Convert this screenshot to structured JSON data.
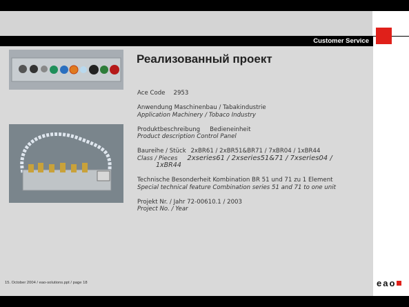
{
  "header": {
    "customer_service": "Customer Service"
  },
  "title": "Реализованный проект",
  "info": {
    "ace_label": "Ace Code",
    "ace_value": "2953",
    "anwendung_label": "Anwendung",
    "anwendung_value": "Maschinenbau / Tabakindustrie",
    "application_label": "Application",
    "application_value": "Machinery / Tobaco Industry",
    "produkt_label": "Produktbeschreibung",
    "produkt_value": "Bedieneinheit",
    "product_label": "Product description",
    "product_value": "Control Panel",
    "baureihe_label": "Baureihe / Stück",
    "baureihe_value": "2xBR61 / 2xBR51&BR71 / 7xBR04 / 1xBR44",
    "class_label": "Class / Pieces",
    "class_value": "2xseries61 / 2xseries51&71 / 7xseries04 /",
    "class_value2": "1xBR44",
    "tech_label": "Technische Besonderheit",
    "tech_value": "Kombination BR 51 und 71 zu 1 Element",
    "special_label": "Special technical feature",
    "special_value": "Combination series 51 and 71 to one unit",
    "projekt_label": "Projekt Nr. / Jahr",
    "projekt_value": "72-00610.1 / 2003",
    "project_label": "Project No. / Year"
  },
  "footer": "15. October 2004 / eao-solutions.ppt / page 18",
  "logo": "eao"
}
